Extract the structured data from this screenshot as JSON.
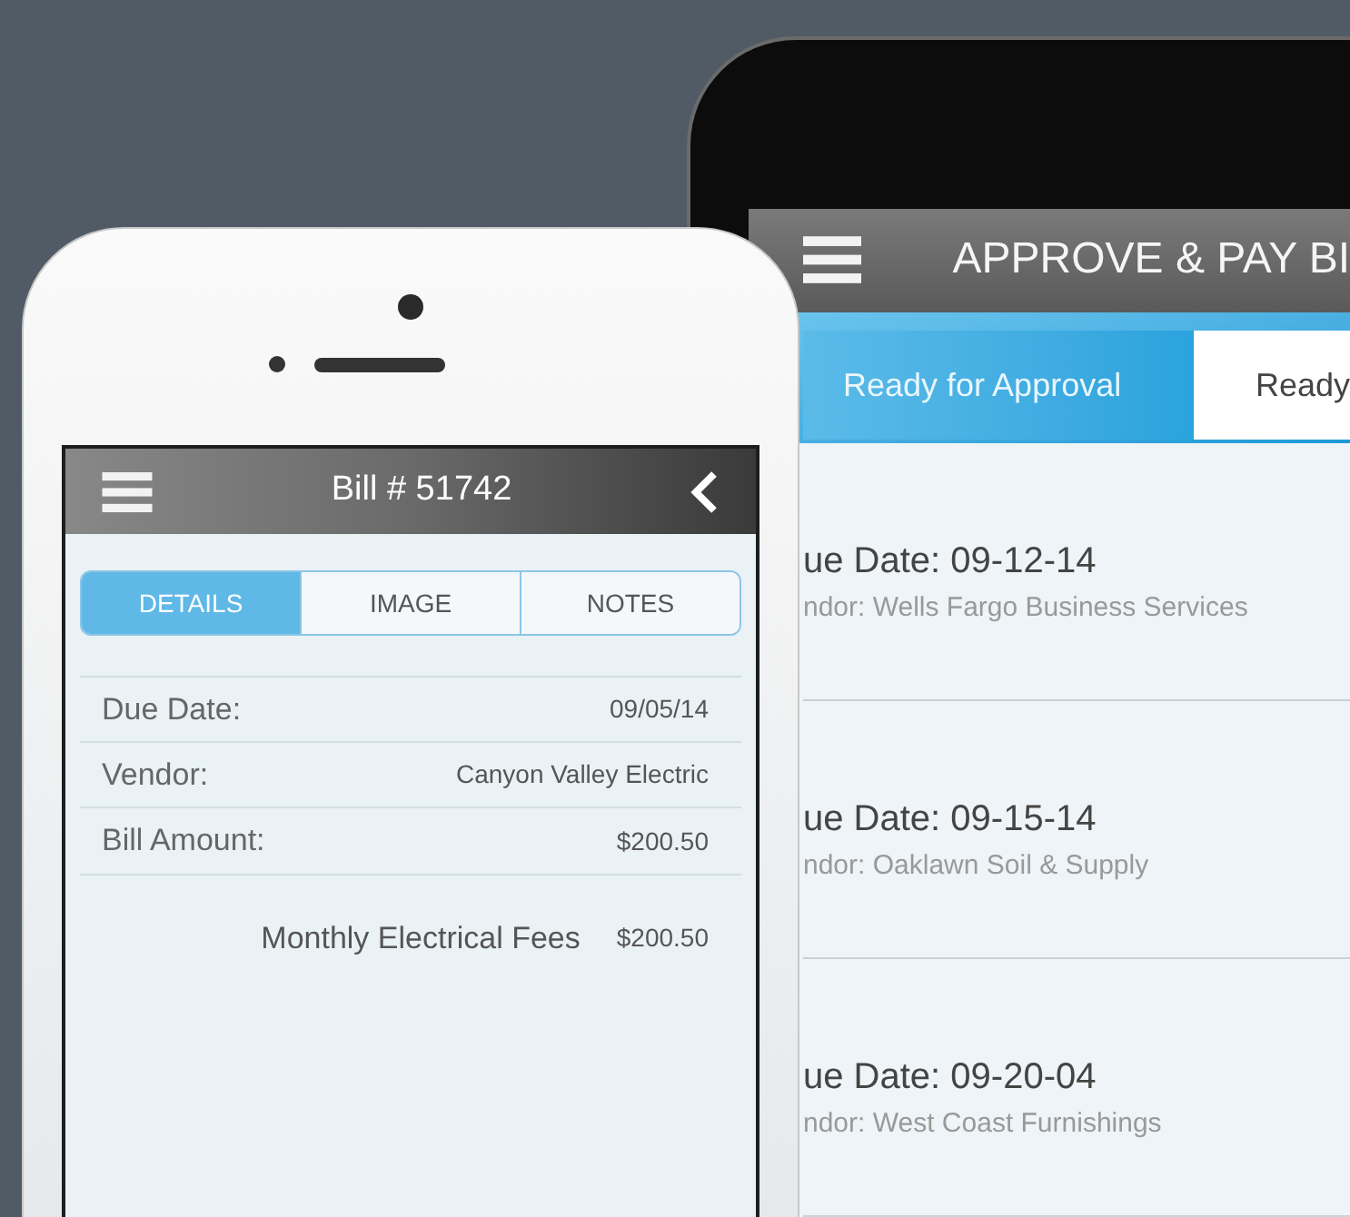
{
  "back_phone": {
    "title": "APPROVE & PAY BI",
    "tabs": [
      {
        "label": "Ready for Approval",
        "selected": true
      },
      {
        "label": "Ready",
        "selected": false
      }
    ],
    "bills": [
      {
        "due": "ue Date: 09-12-14",
        "vendor": "ndor: Wells Fargo Business Services"
      },
      {
        "due": "ue Date: 09-15-14",
        "vendor": "ndor: Oaklawn Soil & Supply"
      },
      {
        "due": "ue Date: 09-20-04",
        "vendor": "ndor: West Coast Furnishings"
      }
    ]
  },
  "front_phone": {
    "title": "Bill # 51742",
    "tabs": [
      {
        "label": "DETAILS",
        "selected": true
      },
      {
        "label": "IMAGE",
        "selected": false
      },
      {
        "label": "NOTES",
        "selected": false
      }
    ],
    "fields": [
      {
        "label": "Due Date:",
        "value": "09/05/14"
      },
      {
        "label": "Vendor:",
        "value": "Canyon Valley Electric"
      },
      {
        "label": "Bill Amount:",
        "value": "$200.50"
      }
    ],
    "line_items": [
      {
        "description": "Monthly Electrical Fees",
        "amount": "$200.50"
      }
    ]
  }
}
